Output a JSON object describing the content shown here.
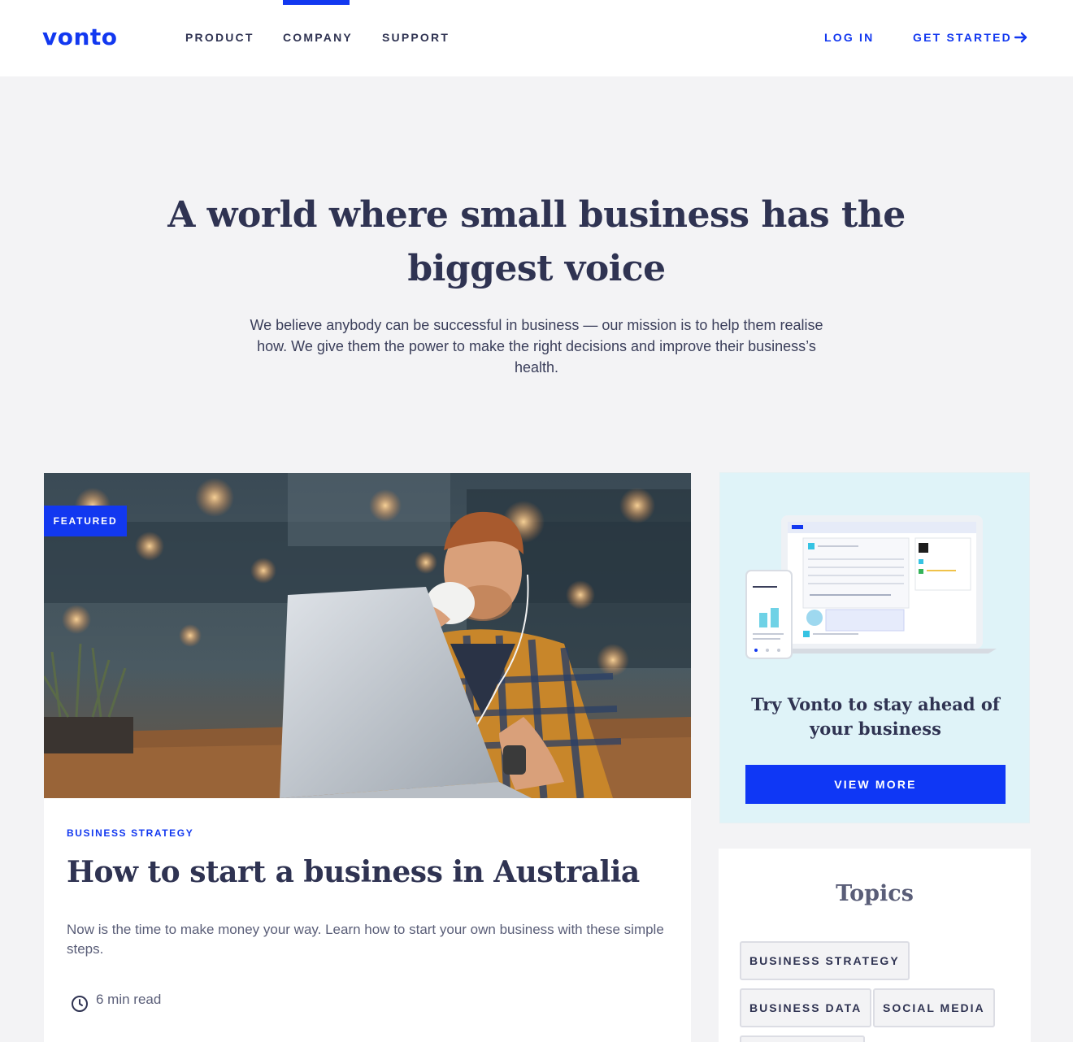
{
  "header": {
    "logo": "vonto",
    "nav": [
      {
        "label": "PRODUCT"
      },
      {
        "label": "COMPANY",
        "active": true
      },
      {
        "label": "SUPPORT"
      }
    ],
    "login": "LOG IN",
    "get_started": "GET STARTED"
  },
  "hero": {
    "title": "A world where small business has the biggest voice",
    "text": "We believe anybody can be successful in business — our mission is to help them realise how. We give them the power to make the right decisions and improve their business’s health."
  },
  "featured": {
    "badge": "FEATURED",
    "category": "BUSINESS STRATEGY",
    "title": "How to start a business in Australia",
    "excerpt": "Now is the time to make money your way. Learn how to start your own business with these simple steps.",
    "read_time": "6 min read"
  },
  "promo": {
    "title": "Try Vonto to stay ahead of your business",
    "button": "VIEW MORE"
  },
  "topics": {
    "title": "Topics",
    "chips": [
      "BUSINESS STRATEGY",
      "BUSINESS DATA",
      "SOCIAL MEDIA"
    ]
  },
  "colors": {
    "accent": "#1238f0",
    "text": "#2f3352",
    "page_bg": "#f3f3f5",
    "promo_bg": "#dff3f8"
  }
}
